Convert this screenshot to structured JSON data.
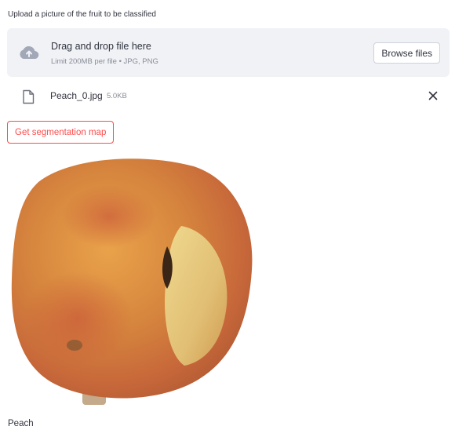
{
  "uploader": {
    "label": "Upload a picture of the fruit to be classified",
    "dropzone": {
      "title": "Drag and drop file here",
      "subtitle": "Limit 200MB per file • JPG, PNG",
      "browse_label": "Browse files",
      "icon": "cloud-upload-icon"
    },
    "file": {
      "name": "Peach_0.jpg",
      "size": "5.0KB",
      "icon": "file-icon",
      "remove_icon": "close-icon"
    }
  },
  "actions": {
    "segmentation_label": "Get segmentation map"
  },
  "result": {
    "caption": "Peach"
  },
  "colors": {
    "text": "#31333f",
    "muted": "#8a8d97",
    "dropzone_bg": "#f0f2f6",
    "accent": "#ff4b4b"
  }
}
